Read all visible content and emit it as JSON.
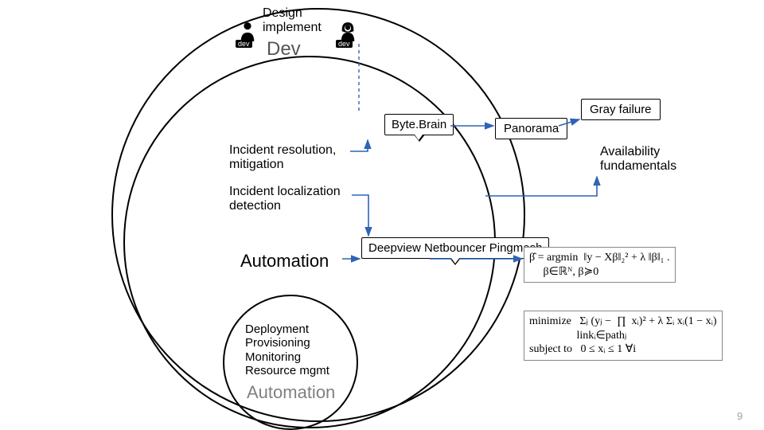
{
  "header": {
    "design_label": "Design\nimplement",
    "dev_label": "Dev"
  },
  "persons": {
    "left_tag": "dev",
    "right_tag": "dev"
  },
  "left_column": {
    "incident_resolution": "Incident resolution,\nmitigation",
    "incident_localization": "Incident localization\ndetection",
    "automation": "Automation",
    "inner_list": "Deployment\nProvisioning\nMonitoring\nResource mgmt",
    "automation_ghost": "Automation"
  },
  "callouts": {
    "bytebrain": "Byte.Brain",
    "panorama": "Panorama",
    "deepview": "Deepview\nNetbouncer\nPingmesh",
    "gray_failure": "Gray\nfailure"
  },
  "right": {
    "avail_fund": "Availability\nfundamentals"
  },
  "equations": {
    "eq1": "β̂ = argmin  ‖y − Xβ‖₂² + λ ‖β‖₁ .\n     β∈ℝᴺ, β≽0",
    "eq2": "minimize   Σⱼ (yⱼ −  ∏  xᵢ)² + λ Σᵢ xᵢ(1 − xᵢ)\n                 linkᵢ∈pathⱼ\nsubject to   0 ≤ xᵢ ≤ 1 ∀i"
  },
  "page_number": "9"
}
